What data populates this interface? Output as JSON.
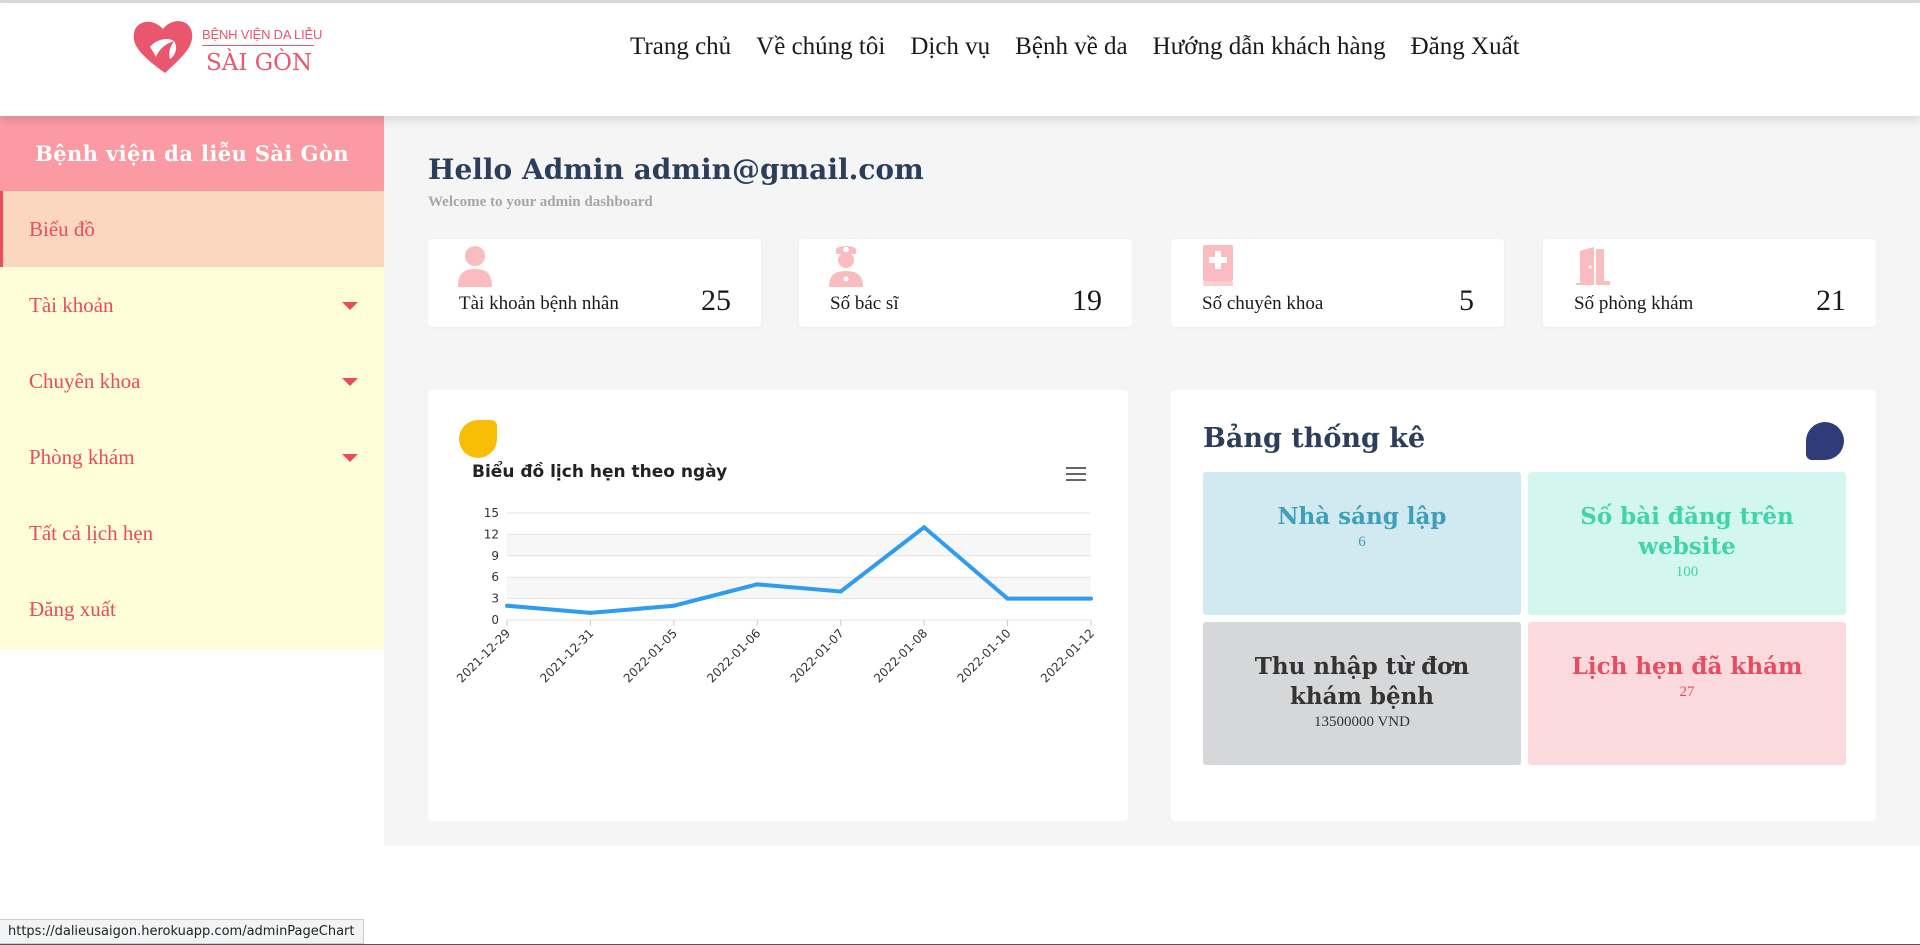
{
  "header": {
    "logo_top": "BỆNH VIỆN DA LIỄU",
    "logo_main": "SÀI GÒN",
    "nav": [
      "Trang chủ",
      "Về chúng tôi",
      "Dịch vụ",
      "Bệnh về da",
      "Hướng dẫn khách hàng",
      "Đăng Xuất"
    ]
  },
  "sidebar": {
    "title": "Bệnh viện da liễu Sài Gòn",
    "items": [
      {
        "label": "Biểu đồ",
        "active": true,
        "caret": false
      },
      {
        "label": "Tài khoản",
        "active": false,
        "caret": true
      },
      {
        "label": "Chuyên khoa",
        "active": false,
        "caret": true
      },
      {
        "label": "Phòng khám",
        "active": false,
        "caret": true
      },
      {
        "label": "Tất cả lịch hẹn",
        "active": false,
        "caret": false
      },
      {
        "label": "Đăng xuất",
        "active": false,
        "caret": false
      }
    ]
  },
  "main": {
    "greeting": "Hello Admin admin@gmail.com",
    "subtitle": "Welcome to your admin dashboard",
    "stats": [
      {
        "label": "Tài khoản bệnh nhân",
        "value": "25",
        "icon": "user-icon"
      },
      {
        "label": "Số bác sĩ",
        "value": "19",
        "icon": "doctor-icon"
      },
      {
        "label": "Số chuyên khoa",
        "value": "5",
        "icon": "medical-book-icon"
      },
      {
        "label": "Số phòng khám",
        "value": "21",
        "icon": "door-open-icon"
      }
    ]
  },
  "chart_data": {
    "type": "line",
    "title": "Biểu đồ lịch hẹn theo ngày",
    "categories": [
      "2021-12-29",
      "2021-12-31",
      "2022-01-05",
      "2022-01-06",
      "2022-01-07",
      "2022-01-08",
      "2022-01-10",
      "2022-01-12"
    ],
    "values": [
      2,
      1,
      2,
      5,
      4,
      13,
      3,
      3
    ],
    "ylim": [
      0,
      15
    ],
    "yticks": [
      "0",
      "3",
      "6",
      "9",
      "12",
      "15"
    ],
    "grid": true,
    "color": "#2e9cf0"
  },
  "stats_panel": {
    "title": "Bảng thống kê",
    "tiles": [
      {
        "label": "Nhà sáng lập",
        "value": "6",
        "bg": "#d1e9f0",
        "color": "#3f9fbb"
      },
      {
        "label": "Số bài đăng trên website",
        "value": "100",
        "bg": "#d3f7ee",
        "color": "#3fd4aa"
      },
      {
        "label": "Thu nhập từ đơn khám bệnh",
        "value": "13500000 VND",
        "bg": "#d6d7d9",
        "color": "#333333"
      },
      {
        "label": "Lịch hẹn đã khám",
        "value": "27",
        "bg": "#fbdadd",
        "color": "#e84c60"
      }
    ]
  },
  "statusbar": {
    "url": "https://dalieusaigon.herokuapp.com/adminPageChart"
  },
  "colors": {
    "accent": "#e84c60",
    "sidebar_head": "#fb9aa3",
    "blob_yellow": "#f8bd05",
    "blob_navy": "#2f3c78"
  }
}
